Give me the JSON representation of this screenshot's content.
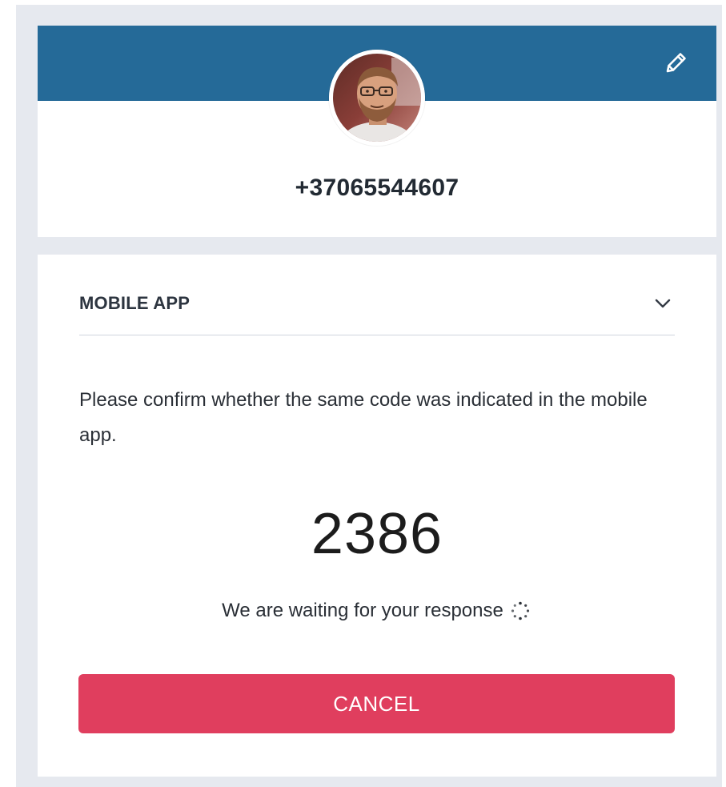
{
  "colors": {
    "header": "#256a98",
    "cancel": "#e03e5e",
    "background": "#e6e9ef"
  },
  "profile": {
    "phone": "+37065544607",
    "avatar_icon": "user-photo",
    "edit_icon": "pencil-icon"
  },
  "method": {
    "label": "MOBILE APP",
    "toggle_icon": "chevron-down-icon"
  },
  "confirmation": {
    "instruction": "Please confirm whether the same code was indicated in the mobile app.",
    "code": "2386",
    "waiting_text": "We are waiting for your response",
    "spinner_icon": "loading-spinner-icon"
  },
  "actions": {
    "cancel_label": "CANCEL"
  }
}
